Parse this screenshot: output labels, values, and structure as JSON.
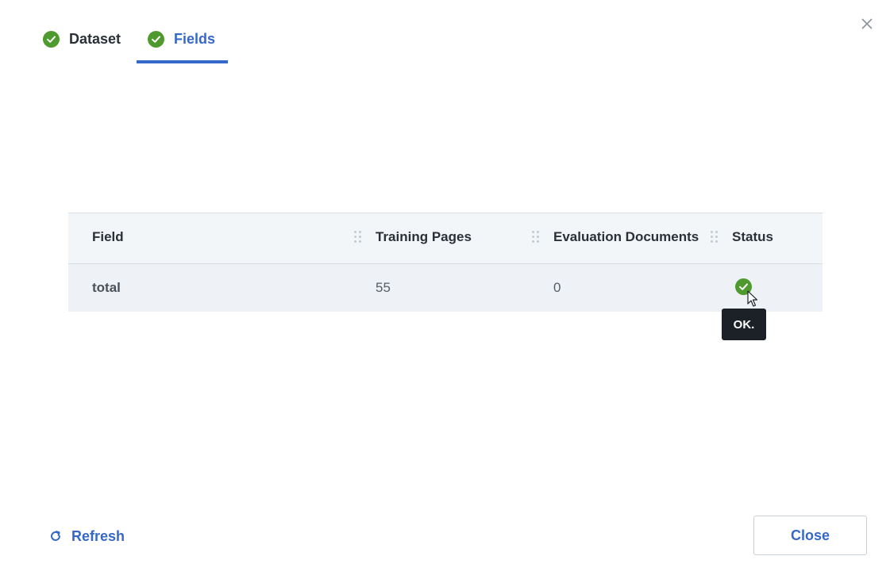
{
  "tabs": [
    {
      "label": "Dataset",
      "icon": "check-circle-icon",
      "active": false
    },
    {
      "label": "Fields",
      "icon": "check-circle-icon",
      "active": true
    }
  ],
  "table": {
    "columns": [
      "Field",
      "Training Pages",
      "Evaluation Documents",
      "Status"
    ],
    "rows": [
      {
        "field": "total",
        "training_pages": "55",
        "evaluation_documents": "0",
        "status_icon": "check-circle-icon"
      }
    ]
  },
  "tooltip": {
    "text": "OK."
  },
  "footer": {
    "refresh_label": "Refresh",
    "close_label": "Close"
  },
  "colors": {
    "accent": "#3568c8",
    "success": "#4f9a2f",
    "tooltip_bg": "#1c2027"
  }
}
